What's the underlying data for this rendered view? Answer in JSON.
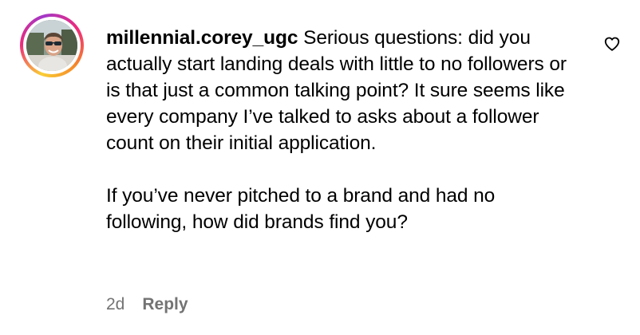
{
  "comment": {
    "username": "millennial.corey_ugc",
    "paragraphs": [
      "Serious questions: did you actually start landing deals with little to no followers or is that just a common talking point? It sure seems like every company I’ve talked to asks about a follower count on their initial application.",
      "If you’ve never pitched to a brand and had no following, how did brands find you?"
    ],
    "timestamp": "2d",
    "reply_label": "Reply",
    "like_icon": "heart-outline-icon"
  },
  "colors": {
    "text": "#000000",
    "meta_text": "#737373",
    "story_ring": [
      "#f9ce34",
      "#ee2a7b",
      "#a238c8"
    ]
  }
}
